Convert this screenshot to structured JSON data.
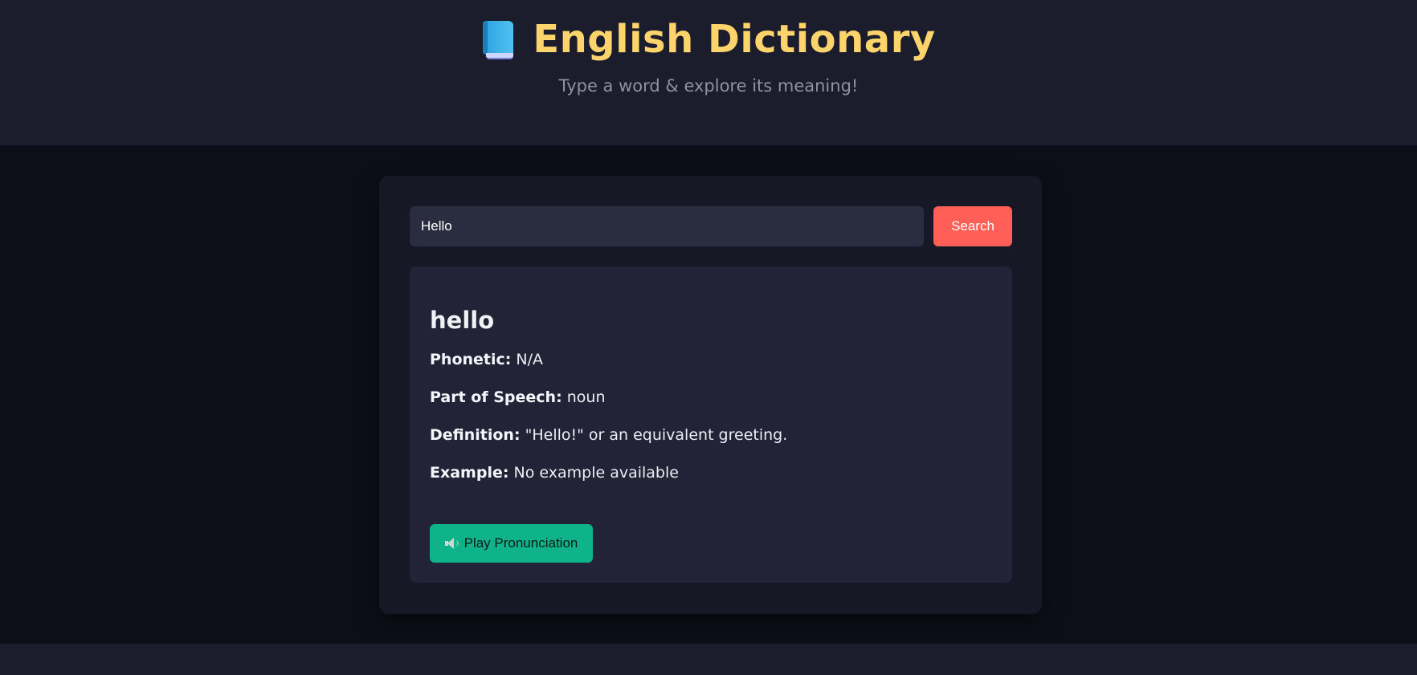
{
  "header": {
    "icon": "book-icon",
    "title": "English Dictionary",
    "subtitle": "Type a word & explore its meaning!"
  },
  "search": {
    "value": "Hello",
    "button_label": "Search"
  },
  "result": {
    "word": "hello",
    "phonetic_label": "Phonetic:",
    "phonetic_value": "N/A",
    "pos_label": "Part of Speech:",
    "pos_value": "noun",
    "definition_label": "Definition:",
    "definition_value": "\"Hello!\" or an equivalent greeting.",
    "example_label": "Example:",
    "example_value": "No example available",
    "play_icon": "speaker-icon",
    "play_label": "Play Pronunciation"
  },
  "colors": {
    "title": "#fdd36b",
    "search_button": "#ff5f57",
    "play_button": "#0fb38a",
    "header_bg": "#1b1c2c",
    "page_bg": "#0d0e18"
  }
}
